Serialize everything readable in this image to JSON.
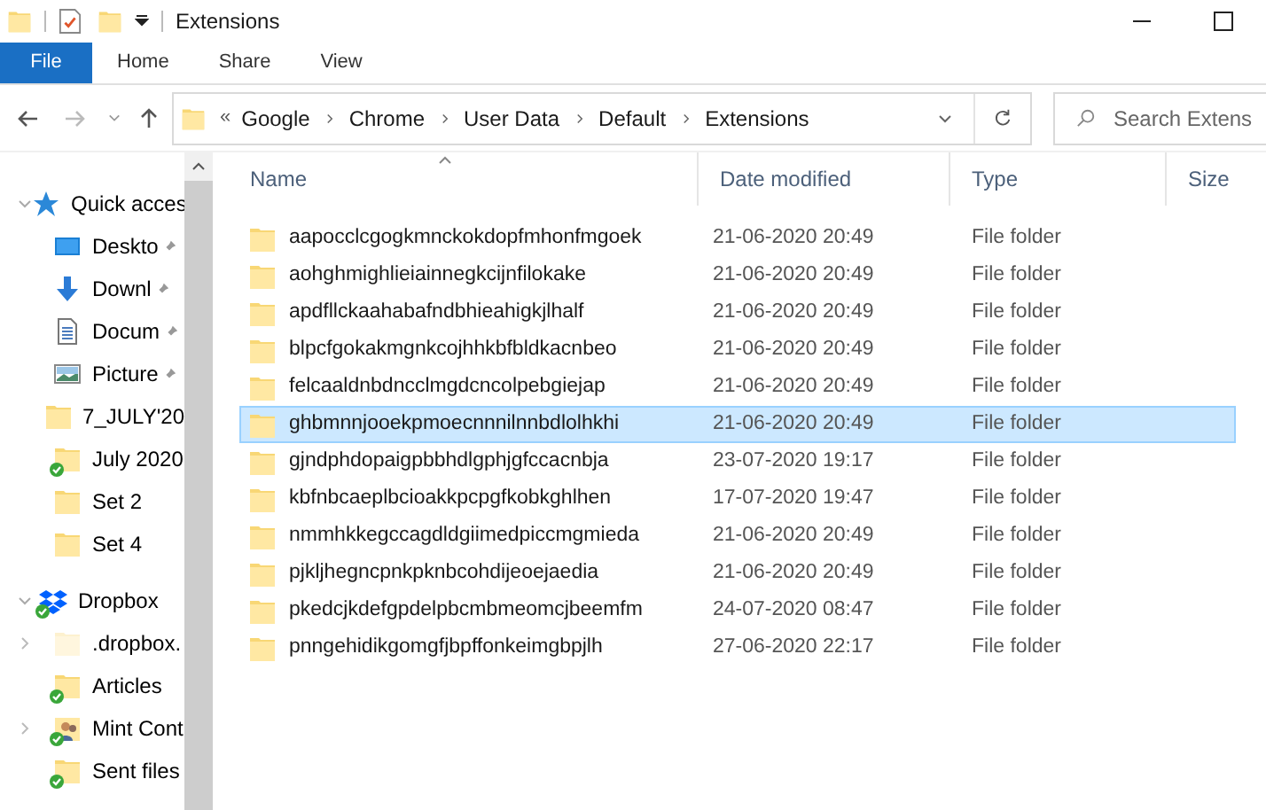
{
  "window": {
    "title": "Extensions"
  },
  "ribbon_tabs": [
    {
      "label": "File",
      "selected": true
    },
    {
      "label": "Home",
      "selected": false
    },
    {
      "label": "Share",
      "selected": false
    },
    {
      "label": "View",
      "selected": false
    }
  ],
  "address": {
    "overflow": "«",
    "crumbs": [
      "Google",
      "Chrome",
      "User Data",
      "Default",
      "Extensions"
    ]
  },
  "search": {
    "placeholder": "Search Extens"
  },
  "sidebar": {
    "items": [
      {
        "label": "Quick acces",
        "kind": "star",
        "expanded": true,
        "pinned": false,
        "synced": false,
        "children": [
          {
            "label": "Deskto",
            "kind": "desktop",
            "pinned": true,
            "synced": false
          },
          {
            "label": "Downl",
            "kind": "download",
            "pinned": true,
            "synced": false
          },
          {
            "label": "Docum",
            "kind": "document",
            "pinned": true,
            "synced": false
          },
          {
            "label": "Picture",
            "kind": "picture",
            "pinned": true,
            "synced": false
          },
          {
            "label": "7_JULY'20",
            "kind": "folder",
            "pinned": false,
            "synced": false
          },
          {
            "label": "July 2020",
            "kind": "folder",
            "pinned": false,
            "synced": true
          },
          {
            "label": "Set 2",
            "kind": "folder",
            "pinned": false,
            "synced": false
          },
          {
            "label": "Set 4",
            "kind": "folder",
            "pinned": false,
            "synced": false
          }
        ]
      },
      {
        "label": "Dropbox",
        "kind": "dropbox",
        "expanded": true,
        "pinned": false,
        "synced": true,
        "children": [
          {
            "label": ".dropbox.",
            "kind": "hidden-folder",
            "expandable": true,
            "pinned": false,
            "synced": false
          },
          {
            "label": "Articles",
            "kind": "folder",
            "expandable": false,
            "pinned": false,
            "synced": true
          },
          {
            "label": "Mint Cont",
            "kind": "people",
            "expandable": true,
            "pinned": false,
            "synced": true
          },
          {
            "label": "Sent files",
            "kind": "folder",
            "expandable": false,
            "pinned": false,
            "synced": true
          }
        ]
      }
    ]
  },
  "table": {
    "columns": [
      "Name",
      "Date modified",
      "Type",
      "Size"
    ],
    "rows": [
      {
        "name": "aapocclcgogkmnckokdopfmhonfmgoek",
        "date": "21-06-2020 20:49",
        "type": "File folder",
        "selected": false
      },
      {
        "name": "aohghmighlieiainnegkcijnfilokake",
        "date": "21-06-2020 20:49",
        "type": "File folder",
        "selected": false
      },
      {
        "name": "apdfllckaahabafndbhieahigkjlhalf",
        "date": "21-06-2020 20:49",
        "type": "File folder",
        "selected": false
      },
      {
        "name": "blpcfgokakmgnkcojhhkbfbldkacnbeo",
        "date": "21-06-2020 20:49",
        "type": "File folder",
        "selected": false
      },
      {
        "name": "felcaaldnbdncclmgdcncolpebgiejap",
        "date": "21-06-2020 20:49",
        "type": "File folder",
        "selected": false
      },
      {
        "name": "ghbmnnjooekpmoecnnnilnnbdlolhkhi",
        "date": "21-06-2020 20:49",
        "type": "File folder",
        "selected": true
      },
      {
        "name": "gjndphdopaigpbbhdlgphjgfccacnbja",
        "date": "23-07-2020 19:17",
        "type": "File folder",
        "selected": false
      },
      {
        "name": "kbfnbcaeplbcioakkpcpgfkobkghlhen",
        "date": "17-07-2020 19:47",
        "type": "File folder",
        "selected": false
      },
      {
        "name": "nmmhkkegccagdldgiimedpiccmgmieda",
        "date": "21-06-2020 20:49",
        "type": "File folder",
        "selected": false
      },
      {
        "name": "pjkljhegncpnkpknbcohdijeoejaedia",
        "date": "21-06-2020 20:49",
        "type": "File folder",
        "selected": false
      },
      {
        "name": "pkedcjkdefgpdelpbcmbmeomcjbeemfm",
        "date": "24-07-2020 08:47",
        "type": "File folder",
        "selected": false
      },
      {
        "name": "pnngehidikgomgfjbpffonkeimgbpjlh",
        "date": "27-06-2020 22:17",
        "type": "File folder",
        "selected": false
      }
    ]
  }
}
